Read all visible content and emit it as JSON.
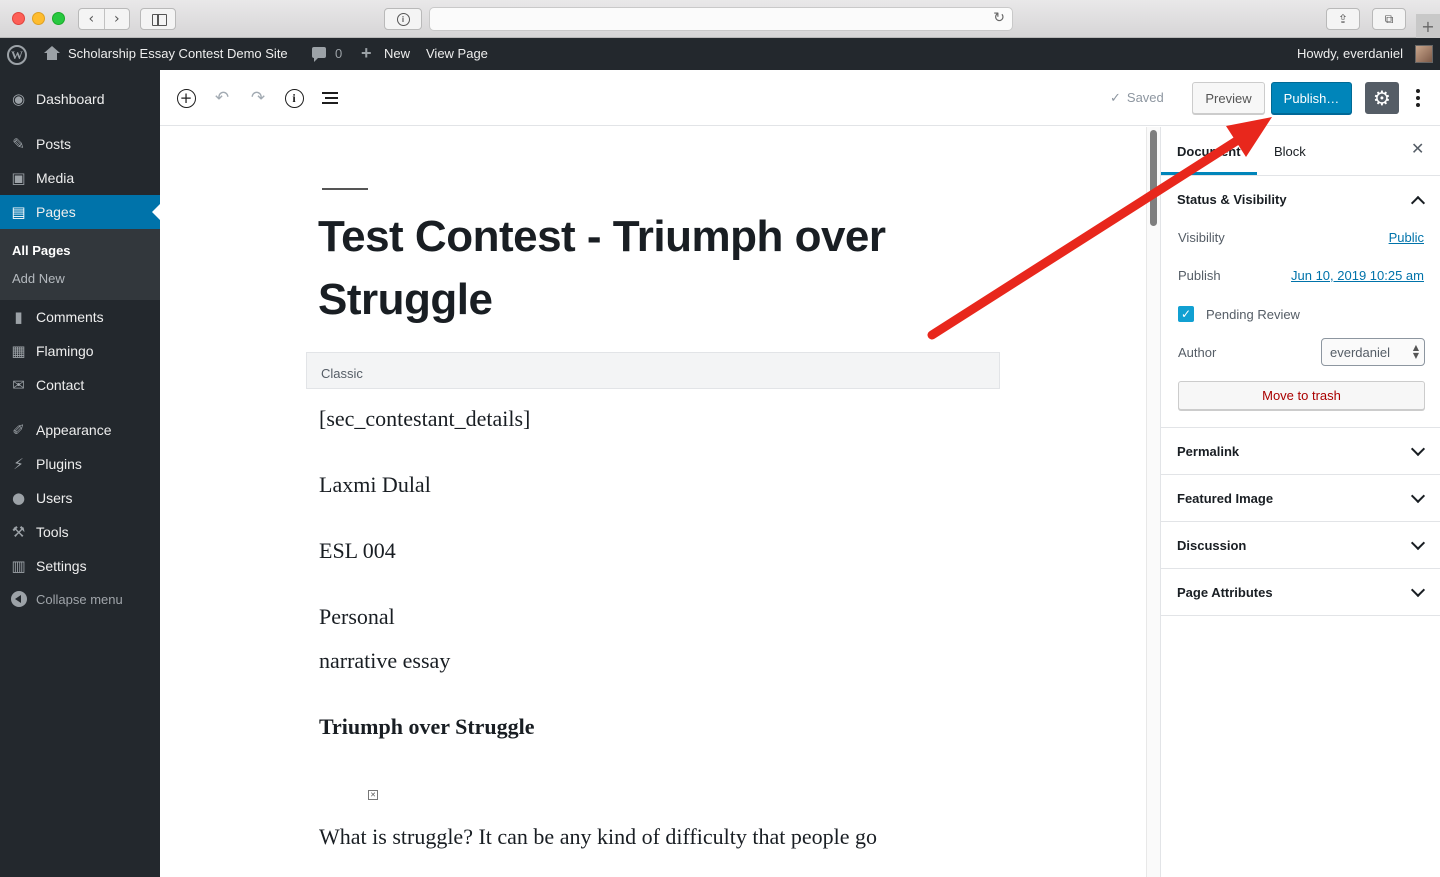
{
  "browser": {
    "back_icon": "‹",
    "forward_icon": "›",
    "reload_icon": "↻",
    "share_icon": "⇪",
    "tabs_icon": "⧉",
    "newtab_icon": "+"
  },
  "admin_bar": {
    "site_name": "Scholarship Essay Contest Demo Site",
    "comments_count": "0",
    "new_label": "New",
    "view_page_label": "View Page",
    "howdy": "Howdy, everdaniel"
  },
  "admin_menu": {
    "items": [
      {
        "label": "Dashboard",
        "icon": "dashboard-icon",
        "glyph": "◉"
      },
      {
        "label": "Posts",
        "icon": "pushpin-icon",
        "glyph": "✎"
      },
      {
        "label": "Media",
        "icon": "media-icon",
        "glyph": "▣"
      },
      {
        "label": "Pages",
        "icon": "pages-icon",
        "glyph": "▤"
      },
      {
        "label": "Comments",
        "icon": "comments-icon",
        "glyph": "▮"
      },
      {
        "label": "Flamingo",
        "icon": "flamingo-icon",
        "glyph": "▦"
      },
      {
        "label": "Contact",
        "icon": "mail-icon",
        "glyph": "✉"
      },
      {
        "label": "Appearance",
        "icon": "brush-icon",
        "glyph": "✐"
      },
      {
        "label": "Plugins",
        "icon": "plugin-icon",
        "glyph": "⚡"
      },
      {
        "label": "Users",
        "icon": "users-icon",
        "glyph": "●"
      },
      {
        "label": "Tools",
        "icon": "wrench-icon",
        "glyph": "⚒"
      },
      {
        "label": "Settings",
        "icon": "sliders-icon",
        "glyph": "▥"
      },
      {
        "label": "Collapse menu",
        "icon": "collapse-icon",
        "glyph": ""
      }
    ],
    "submenu": {
      "all_pages": "All Pages",
      "add_new": "Add New"
    }
  },
  "editor_header": {
    "saved_label": "Saved",
    "preview_label": "Preview",
    "publish_label": "Publish…",
    "undo_glyph": "↶",
    "redo_glyph": "↷",
    "settings_glyph": "⚙"
  },
  "editor": {
    "title": "Test Contest - Triumph over Struggle",
    "classic_label": "Classic",
    "content": [
      "[sec_contestant_details]",
      "Laxmi Dulal",
      "ESL 004",
      "Personal",
      "narrative essay",
      "Triumph over Struggle",
      "What is struggle? It can be any kind of difficulty that people go"
    ]
  },
  "sidebar": {
    "tab_document": "Document",
    "tab_block": "Block",
    "close_glyph": "✕",
    "status_title": "Status & Visibility",
    "visibility_label": "Visibility",
    "visibility_value": "Public",
    "publish_label": "Publish",
    "publish_value": "Jun 10, 2019 10:25 am",
    "pending_review": "Pending Review",
    "pending_checked": true,
    "author_label": "Author",
    "author_value": "everdaniel",
    "trash_label": "Move to trash",
    "permalink_title": "Permalink",
    "featured_title": "Featured Image",
    "discussion_title": "Discussion",
    "attributes_title": "Page Attributes"
  },
  "colors": {
    "wp_dark": "#23282d",
    "wp_blue": "#0073aa",
    "publish_blue": "#0085ba",
    "arrow_red": "#e8271c"
  }
}
